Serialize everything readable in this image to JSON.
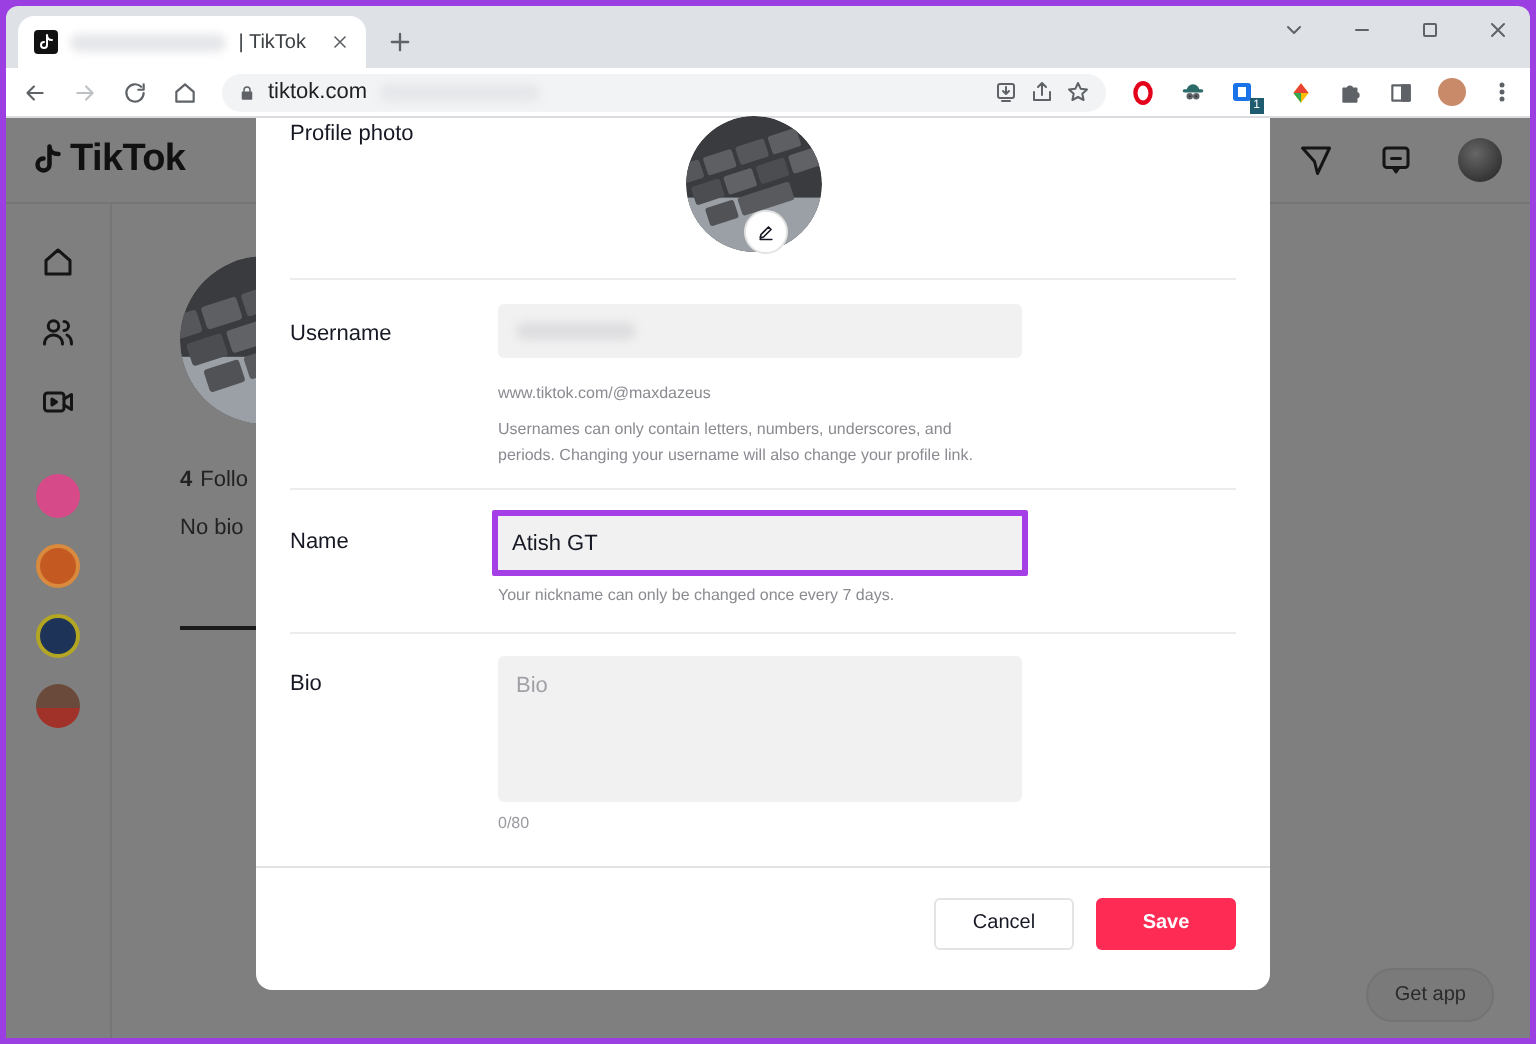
{
  "browser": {
    "tab": {
      "title": "| TikTok"
    },
    "address": "tiktok.com",
    "extension_badge": "1"
  },
  "page": {
    "logo": "TikTok",
    "profile": {
      "following_count": "4",
      "following_label": "Follo",
      "bio": "No bio"
    },
    "get_app": "Get app"
  },
  "modal": {
    "profile_photo": {
      "label": "Profile photo"
    },
    "username": {
      "label": "Username",
      "url": "www.tiktok.com/@maxdazeus",
      "help": "Usernames can only contain letters, numbers, underscores, and periods. Changing your username will also change your profile link."
    },
    "name": {
      "label": "Name",
      "value": "Atish GT",
      "highlighted": true,
      "help": "Your nickname can only be changed once every 7 days."
    },
    "bio": {
      "label": "Bio",
      "placeholder": "Bio",
      "counter": "0/80"
    },
    "buttons": [
      {
        "label": "Cancel",
        "kind": "secondary"
      },
      {
        "label": "Save",
        "kind": "primary"
      }
    ]
  }
}
